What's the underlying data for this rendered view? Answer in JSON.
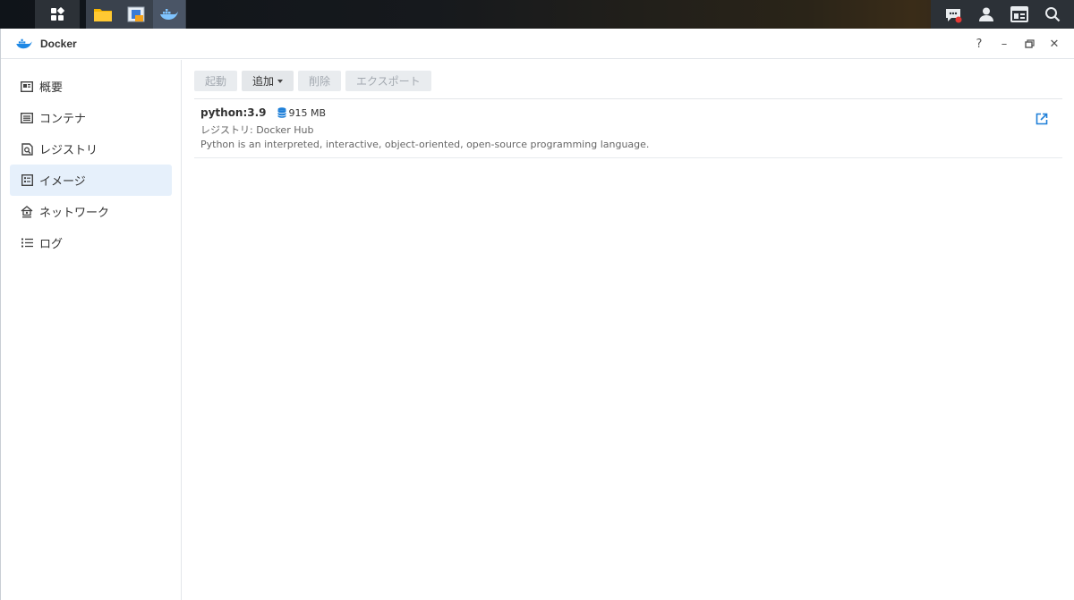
{
  "window": {
    "title": "Docker"
  },
  "window_controls": {
    "help": "?",
    "minimize": "–",
    "restore": "🗗",
    "close": "✕"
  },
  "sidebar": {
    "items": [
      {
        "label": "概要",
        "icon": "overview-icon",
        "active": false
      },
      {
        "label": "コンテナ",
        "icon": "container-icon",
        "active": false
      },
      {
        "label": "レジストリ",
        "icon": "registry-icon",
        "active": false
      },
      {
        "label": "イメージ",
        "icon": "image-icon",
        "active": true
      },
      {
        "label": "ネットワーク",
        "icon": "network-icon",
        "active": false
      },
      {
        "label": "ログ",
        "icon": "log-icon",
        "active": false
      }
    ]
  },
  "toolbar": {
    "launch": "起動",
    "add": "追加",
    "delete": "削除",
    "export": "エクスポート"
  },
  "images": [
    {
      "name": "python:3.9",
      "size": "915 MB",
      "registry": "レジストリ: Docker Hub",
      "description": "Python is an interpreted, interactive, object-oriented, open-source programming language."
    }
  ],
  "colors": {
    "accent": "#1e7fd8",
    "active_nav": "#e6f0fb",
    "notification": "#e53935"
  }
}
